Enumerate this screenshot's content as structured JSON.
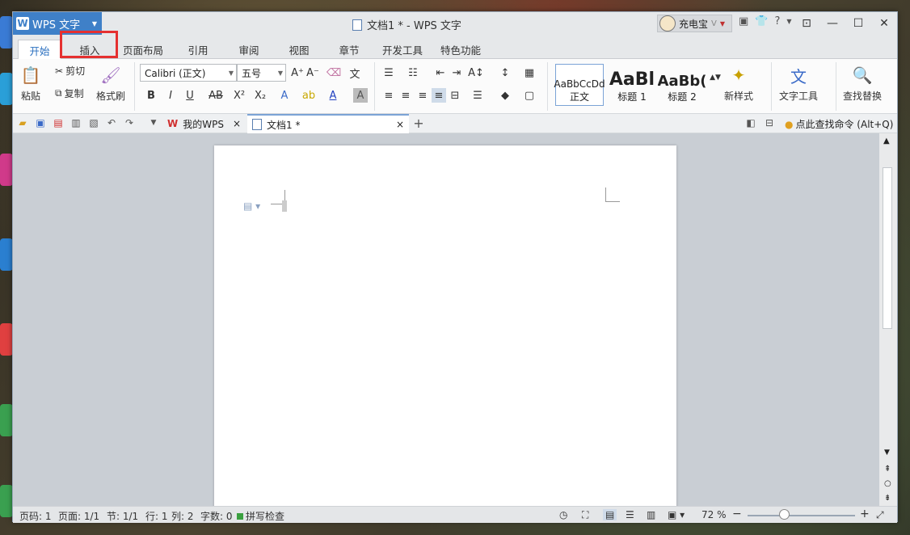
{
  "app": {
    "name": "WPS 文字",
    "window_title": "文档1 * - WPS 文字"
  },
  "user": {
    "name": "充电宝"
  },
  "menu_tabs": [
    "开始",
    "插入",
    "页面布局",
    "引用",
    "审阅",
    "视图",
    "章节",
    "开发工具",
    "特色功能"
  ],
  "active_tab": "开始",
  "highlighted_tab": "插入",
  "ribbon": {
    "paste": "粘贴",
    "cut": "剪切",
    "copy": "复制",
    "format_painter": "格式刷",
    "font_name": "Calibri (正文)",
    "font_size": "五号",
    "styles": [
      {
        "preview": "AaBbCcDd",
        "label": "正文"
      },
      {
        "preview": "AaBl",
        "label": "标题 1"
      },
      {
        "preview": "AaBb(",
        "label": "标题 2"
      }
    ],
    "new_style": "新样式",
    "text_tools": "文字工具",
    "find_replace": "查找替换"
  },
  "doc_tabs": [
    {
      "label": "我的WPS",
      "active": false
    },
    {
      "label": "文档1 *",
      "active": true
    }
  ],
  "command_search": "点此查找命令 (Alt+Q)",
  "status": {
    "page_num": "页码: 1",
    "pages": "页面: 1/1",
    "section": "节: 1/1",
    "row": "行: 1",
    "col": "列: 2",
    "words": "字数: 0",
    "spell": "拼写检查",
    "zoom": "72 %"
  },
  "colors": {
    "accent": "#3f80c8",
    "highlight_box": "#e53030"
  }
}
